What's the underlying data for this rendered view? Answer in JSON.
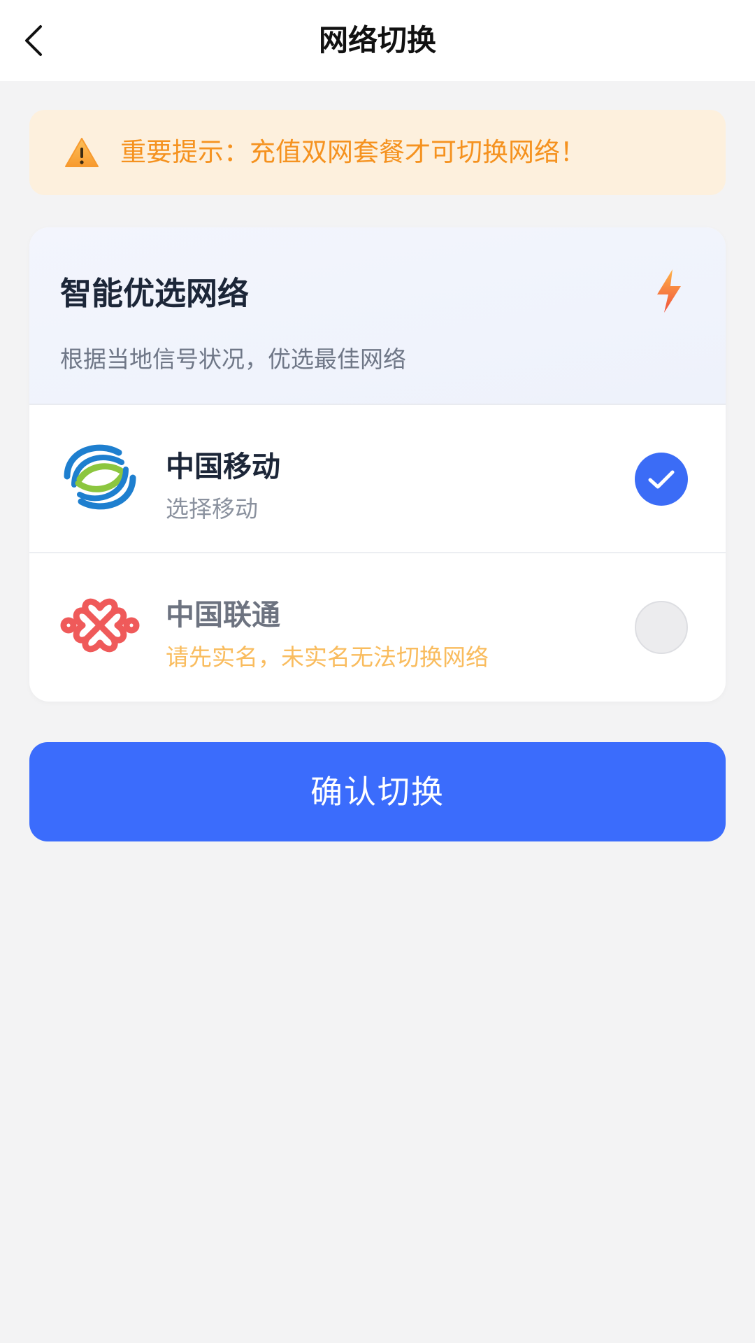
{
  "header": {
    "title": "网络切换",
    "back_icon": "chevron-left-icon"
  },
  "notice": {
    "icon": "warning-icon",
    "text": "重要提示：充值双网套餐才可切换网络！",
    "color": "#f5921f"
  },
  "smart_select": {
    "title": "智能优选网络",
    "description": "根据当地信号状况，优选最佳网络",
    "icon": "lightning-bolt-icon"
  },
  "operators": [
    {
      "name": "中国移动",
      "subtitle": "选择移动",
      "logo": "china-mobile-logo",
      "selected": true
    },
    {
      "name": "中国联通",
      "subtitle": "请先实名，未实名无法切换网络",
      "logo": "china-unicom-logo",
      "selected": false
    }
  ],
  "confirm_button": {
    "label": "确认切换"
  },
  "colors": {
    "accent": "#3b6cfc",
    "warning": "#f5921f",
    "notice_bg": "#fdf0dd"
  }
}
